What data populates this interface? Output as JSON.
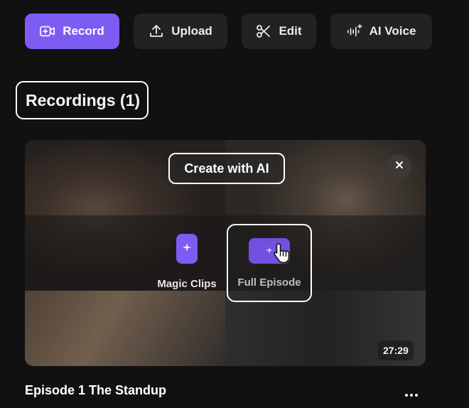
{
  "toolbar": {
    "record": {
      "label": "Record",
      "icon": "video-plus-icon"
    },
    "upload": {
      "label": "Upload",
      "icon": "upload-icon"
    },
    "edit": {
      "label": "Edit",
      "icon": "scissors-icon"
    },
    "ai_voice": {
      "label": "AI Voice",
      "icon": "waveform-sparkle-icon"
    }
  },
  "recordings": {
    "title": "Recordings (1)"
  },
  "card": {
    "create_ai": "Create with AI",
    "magic_clips": "Magic Clips",
    "full_episode": "Full Episode",
    "duration": "27:29"
  },
  "episode": {
    "title": "Episode 1 The Standup"
  },
  "colors": {
    "accent": "#7d5cf3",
    "background": "#111111",
    "button": "#222222"
  }
}
